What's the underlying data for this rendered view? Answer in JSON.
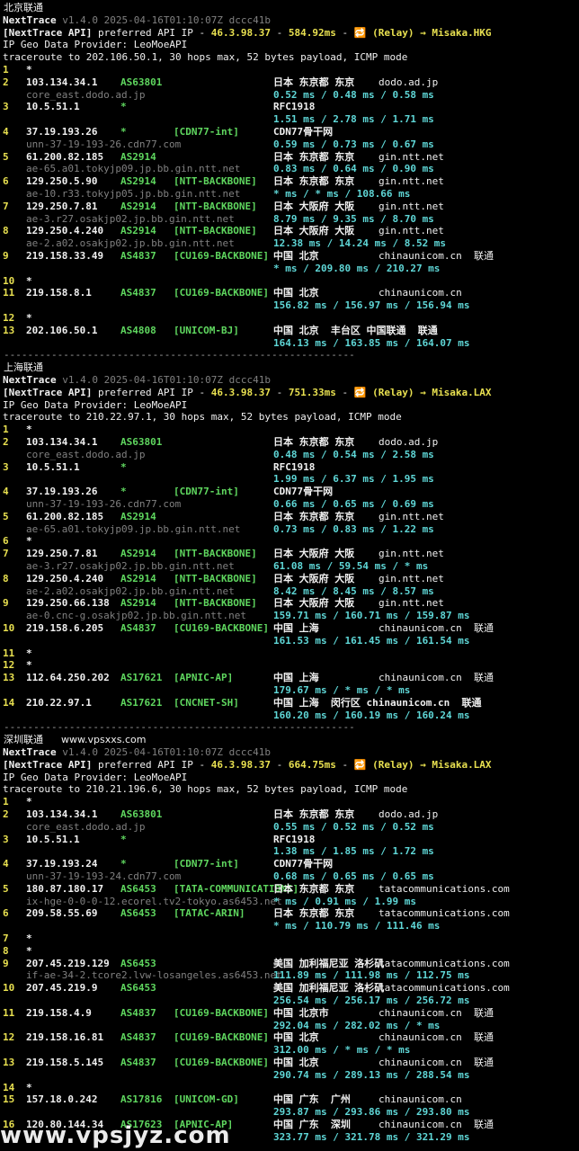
{
  "sections": [
    {
      "title": "北京联通",
      "extra": "",
      "version": "v1.4.0 2025-04-16T01:10:07Z dccc41b",
      "api_ip": "46.3.98.37",
      "api_latency": "584.92ms",
      "relay": "Misaka.HKG",
      "provider": "LeoMoeAPI",
      "target": "202.106.50.1",
      "hops": [
        {
          "n": "1",
          "ip": "*",
          "asn": "",
          "tag": "",
          "geo": "",
          "host": "",
          "rdns": "",
          "times": ""
        },
        {
          "n": "2",
          "ip": "103.134.34.1",
          "asn": "AS63801",
          "tag": "",
          "geo": "日本 东京都 东京",
          "host": "dodo.ad.jp",
          "rdns": "core_east.dodo.ad.jp",
          "times": "0.52 ms / 0.48 ms / 0.58 ms"
        },
        {
          "n": "3",
          "ip": "10.5.51.1",
          "asn": "*",
          "tag": "",
          "geo": "RFC1918",
          "host": "",
          "rdns": "",
          "times": "1.51 ms / 2.78 ms / 1.71 ms"
        },
        {
          "n": "4",
          "ip": "37.19.193.26",
          "asn": "*",
          "tag": "[CDN77-int]",
          "geo": "CDN77骨干网",
          "host": "",
          "rdns": "unn-37-19-193-26.cdn77.com",
          "times": "0.59 ms / 0.73 ms / 0.67 ms"
        },
        {
          "n": "5",
          "ip": "61.200.82.185",
          "asn": "AS2914",
          "tag": "",
          "geo": "日本 东京都 东京",
          "host": "gin.ntt.net",
          "rdns": "ae-65.a01.tokyjp09.jp.bb.gin.ntt.net",
          "times": "0.83 ms / 0.64 ms / 0.90 ms"
        },
        {
          "n": "6",
          "ip": "129.250.5.90",
          "asn": "AS2914",
          "tag": "[NTT-BACKBONE]",
          "geo": "日本 东京都 东京",
          "host": "gin.ntt.net",
          "rdns": "ae-10.r33.tokyjp05.jp.bb.gin.ntt.net",
          "times": "* ms / * ms / 108.66 ms"
        },
        {
          "n": "7",
          "ip": "129.250.7.81",
          "asn": "AS2914",
          "tag": "[NTT-BACKBONE]",
          "geo": "日本 大阪府 大阪",
          "host": "gin.ntt.net",
          "rdns": "ae-3.r27.osakjp02.jp.bb.gin.ntt.net",
          "times": "8.79 ms / 9.35 ms / 8.70 ms"
        },
        {
          "n": "8",
          "ip": "129.250.4.240",
          "asn": "AS2914",
          "tag": "[NTT-BACKBONE]",
          "geo": "日本 大阪府 大阪",
          "host": "gin.ntt.net",
          "rdns": "ae-2.a02.osakjp02.jp.bb.gin.ntt.net",
          "times": "12.38 ms / 14.24 ms / 8.52 ms"
        },
        {
          "n": "9",
          "ip": "219.158.33.49",
          "asn": "AS4837",
          "tag": "[CU169-BACKBONE]",
          "geo": "中国 北京",
          "host": "chinaunicom.cn  联通",
          "rdns": "",
          "times": "* ms / 209.80 ms / 210.27 ms"
        },
        {
          "n": "10",
          "ip": "*",
          "asn": "",
          "tag": "",
          "geo": "",
          "host": "",
          "rdns": "",
          "times": ""
        },
        {
          "n": "11",
          "ip": "219.158.8.1",
          "asn": "AS4837",
          "tag": "[CU169-BACKBONE]",
          "geo": "中国 北京",
          "host": "chinaunicom.cn",
          "rdns": "",
          "times": "156.82 ms / 156.97 ms / 156.94 ms"
        },
        {
          "n": "12",
          "ip": "*",
          "asn": "",
          "tag": "",
          "geo": "",
          "host": "",
          "rdns": "",
          "times": ""
        },
        {
          "n": "13",
          "ip": "202.106.50.1",
          "asn": "AS4808",
          "tag": "[UNICOM-BJ]",
          "geo": "中国 北京  丰台区 中国联通  联通",
          "host": "",
          "rdns": "",
          "times": "164.13 ms / 163.85 ms / 164.07 ms"
        }
      ]
    },
    {
      "title": "上海联通",
      "extra": "",
      "version": "v1.4.0 2025-04-16T01:10:07Z dccc41b",
      "api_ip": "46.3.98.37",
      "api_latency": "751.33ms",
      "relay": "Misaka.LAX",
      "provider": "LeoMoeAPI",
      "target": "210.22.97.1",
      "hops": [
        {
          "n": "1",
          "ip": "*",
          "asn": "",
          "tag": "",
          "geo": "",
          "host": "",
          "rdns": "",
          "times": ""
        },
        {
          "n": "2",
          "ip": "103.134.34.1",
          "asn": "AS63801",
          "tag": "",
          "geo": "日本 东京都 东京",
          "host": "dodo.ad.jp",
          "rdns": "core_east.dodo.ad.jp",
          "times": "0.48 ms / 0.54 ms / 2.58 ms"
        },
        {
          "n": "3",
          "ip": "10.5.51.1",
          "asn": "*",
          "tag": "",
          "geo": "RFC1918",
          "host": "",
          "rdns": "",
          "times": "1.99 ms / 6.37 ms / 1.95 ms"
        },
        {
          "n": "4",
          "ip": "37.19.193.26",
          "asn": "*",
          "tag": "[CDN77-int]",
          "geo": "CDN77骨干网",
          "host": "",
          "rdns": "unn-37-19-193-26.cdn77.com",
          "times": "0.66 ms / 0.65 ms / 0.69 ms"
        },
        {
          "n": "5",
          "ip": "61.200.82.185",
          "asn": "AS2914",
          "tag": "",
          "geo": "日本 东京都 东京",
          "host": "gin.ntt.net",
          "rdns": "ae-65.a01.tokyjp09.jp.bb.gin.ntt.net",
          "times": "0.73 ms / 0.83 ms / 1.22 ms"
        },
        {
          "n": "6",
          "ip": "*",
          "asn": "",
          "tag": "",
          "geo": "",
          "host": "",
          "rdns": "",
          "times": ""
        },
        {
          "n": "7",
          "ip": "129.250.7.81",
          "asn": "AS2914",
          "tag": "[NTT-BACKBONE]",
          "geo": "日本 大阪府 大阪",
          "host": "gin.ntt.net",
          "rdns": "ae-3.r27.osakjp02.jp.bb.gin.ntt.net",
          "times": "61.08 ms / 59.54 ms / * ms"
        },
        {
          "n": "8",
          "ip": "129.250.4.240",
          "asn": "AS2914",
          "tag": "[NTT-BACKBONE]",
          "geo": "日本 大阪府 大阪",
          "host": "gin.ntt.net",
          "rdns": "ae-2.a02.osakjp02.jp.bb.gin.ntt.net",
          "times": "8.42 ms / 8.45 ms / 8.57 ms"
        },
        {
          "n": "9",
          "ip": "129.250.66.138",
          "asn": "AS2914",
          "tag": "[NTT-BACKBONE]",
          "geo": "日本 大阪府 大阪",
          "host": "gin.ntt.net",
          "rdns": "ae-0.cnc-g.osakjp02.jp.bb.gin.ntt.net",
          "times": "159.71 ms / 160.71 ms / 159.87 ms"
        },
        {
          "n": "10",
          "ip": "219.158.6.205",
          "asn": "AS4837",
          "tag": "[CU169-BACKBONE]",
          "geo": "中国 上海",
          "host": "chinaunicom.cn  联通",
          "rdns": "",
          "times": "161.53 ms / 161.45 ms / 161.54 ms"
        },
        {
          "n": "11",
          "ip": "*",
          "asn": "",
          "tag": "",
          "geo": "",
          "host": "",
          "rdns": "",
          "times": ""
        },
        {
          "n": "12",
          "ip": "*",
          "asn": "",
          "tag": "",
          "geo": "",
          "host": "",
          "rdns": "",
          "times": ""
        },
        {
          "n": "13",
          "ip": "112.64.250.202",
          "asn": "AS17621",
          "tag": "[APNIC-AP]",
          "geo": "中国 上海",
          "host": "chinaunicom.cn  联通",
          "rdns": "",
          "times": "179.67 ms / * ms / * ms"
        },
        {
          "n": "14",
          "ip": "210.22.97.1",
          "asn": "AS17621",
          "tag": "[CNCNET-SH]",
          "geo": "中国 上海  闵行区 chinaunicom.cn  联通",
          "host": "",
          "rdns": "",
          "times": "160.20 ms / 160.19 ms / 160.24 ms"
        }
      ]
    },
    {
      "title": "深圳联通",
      "extra": "www.vpsxxs.com",
      "version": "v1.4.0 2025-04-16T01:10:07Z dccc41b",
      "api_ip": "46.3.98.37",
      "api_latency": "664.75ms",
      "relay": "Misaka.LAX",
      "provider": "LeoMoeAPI",
      "target": "210.21.196.6",
      "hops": [
        {
          "n": "1",
          "ip": "*",
          "asn": "",
          "tag": "",
          "geo": "",
          "host": "",
          "rdns": "",
          "times": ""
        },
        {
          "n": "2",
          "ip": "103.134.34.1",
          "asn": "AS63801",
          "tag": "",
          "geo": "日本 东京都 东京",
          "host": "dodo.ad.jp",
          "rdns": "core_east.dodo.ad.jp",
          "times": "0.55 ms / 0.52 ms / 0.52 ms"
        },
        {
          "n": "3",
          "ip": "10.5.51.1",
          "asn": "*",
          "tag": "",
          "geo": "RFC1918",
          "host": "",
          "rdns": "",
          "times": "1.38 ms / 1.85 ms / 1.72 ms"
        },
        {
          "n": "4",
          "ip": "37.19.193.24",
          "asn": "*",
          "tag": "[CDN77-int]",
          "geo": "CDN77骨干网",
          "host": "",
          "rdns": "unn-37-19-193-24.cdn77.com",
          "times": "0.68 ms / 0.65 ms / 0.65 ms"
        },
        {
          "n": "5",
          "ip": "180.87.180.17",
          "asn": "AS6453",
          "tag": "[TATA-COMMUNICATIONS]",
          "geo": "日本 东京都 东京",
          "host": "tatacommunications.com",
          "rdns": "ix-hge-0-0-0-12.ecorel.tv2-tokyo.as6453.net",
          "times": "* ms / 0.91 ms / 1.99 ms"
        },
        {
          "n": "6",
          "ip": "209.58.55.69",
          "asn": "AS6453",
          "tag": "[TATAC-ARIN]",
          "geo": "日本 东京都 东京",
          "host": "tatacommunications.com",
          "rdns": "",
          "times": "* ms / 110.79 ms / 111.46 ms"
        },
        {
          "n": "7",
          "ip": "*",
          "asn": "",
          "tag": "",
          "geo": "",
          "host": "",
          "rdns": "",
          "times": ""
        },
        {
          "n": "8",
          "ip": "*",
          "asn": "",
          "tag": "",
          "geo": "",
          "host": "",
          "rdns": "",
          "times": ""
        },
        {
          "n": "9",
          "ip": "207.45.219.129",
          "asn": "AS6453",
          "tag": "",
          "geo": "美国 加利福尼亚 洛杉矶",
          "host": "tatacommunications.com",
          "rdns": "if-ae-34-2.tcore2.lvw-losangeles.as6453.net",
          "times": "111.89 ms / 111.98 ms / 112.75 ms"
        },
        {
          "n": "10",
          "ip": "207.45.219.9",
          "asn": "AS6453",
          "tag": "",
          "geo": "美国 加利福尼亚 洛杉矶",
          "host": "tatacommunications.com",
          "rdns": "",
          "times": "256.54 ms / 256.17 ms / 256.72 ms"
        },
        {
          "n": "11",
          "ip": "219.158.4.9",
          "asn": "AS4837",
          "tag": "[CU169-BACKBONE]",
          "geo": "中国 北京市",
          "host": "chinaunicom.cn  联通",
          "rdns": "",
          "times": "292.04 ms / 282.02 ms / * ms"
        },
        {
          "n": "12",
          "ip": "219.158.16.81",
          "asn": "AS4837",
          "tag": "[CU169-BACKBONE]",
          "geo": "中国 北京",
          "host": "chinaunicom.cn  联通",
          "rdns": "",
          "times": "312.00 ms / * ms / * ms"
        },
        {
          "n": "13",
          "ip": "219.158.5.145",
          "asn": "AS4837",
          "tag": "[CU169-BACKBONE]",
          "geo": "中国 北京",
          "host": "chinaunicom.cn  联通",
          "rdns": "",
          "times": "290.74 ms / 289.13 ms / 288.54 ms"
        },
        {
          "n": "14",
          "ip": "*",
          "asn": "",
          "tag": "",
          "geo": "",
          "host": "",
          "rdns": "",
          "times": ""
        },
        {
          "n": "15",
          "ip": "157.18.0.242",
          "asn": "AS17816",
          "tag": "[UNICOM-GD]",
          "geo": "中国 广东  广州",
          "host": "chinaunicom.cn",
          "rdns": "",
          "times": "293.87 ms / 293.86 ms / 293.80 ms"
        },
        {
          "n": "16",
          "ip": "120.80.144.34",
          "asn": "AS17623",
          "tag": "[APNIC-AP]",
          "geo": "中国 广东  深圳",
          "host": "chinaunicom.cn  联通",
          "rdns": "",
          "times": "323.77 ms / 321.78 ms / 321.29 ms"
        }
      ]
    }
  ],
  "labels": {
    "app_name": "NextTrace",
    "api_prefix": "[NextTrace API]",
    "api_text": " preferred API IP - ",
    "relay_prefix": " (Relay) → ",
    "provider_label": "IP Geo Data Provider: ",
    "trace_prefix": "traceroute to ",
    "trace_suffix": ", 30 hops max, 52 bytes payload, ICMP mode",
    "separator": "-----------------------------------------------------------",
    "dash": " - ",
    "relay_icon": "🔁"
  },
  "watermark": "www.vpsjyz.com"
}
